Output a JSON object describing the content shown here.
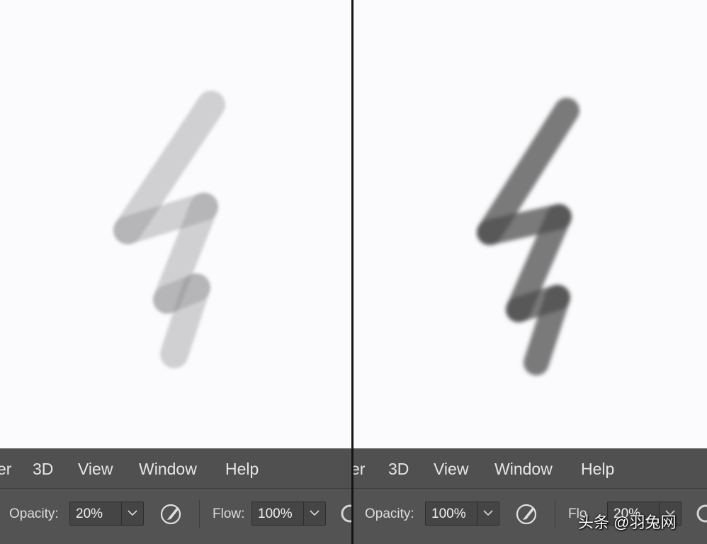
{
  "left_panel": {
    "menu": [
      "er",
      "3D",
      "View",
      "Window",
      "Help"
    ],
    "options": {
      "opacity_label": "Opacity:",
      "opacity_value": "20%",
      "flow_label": "Flow:",
      "flow_value": "100%"
    }
  },
  "right_panel": {
    "menu": [
      "er",
      "3D",
      "View",
      "Window",
      "Help"
    ],
    "options": {
      "opacity_label": "Opacity:",
      "opacity_value": "100%",
      "flow_label": "Flo",
      "flow_value": "20%"
    }
  },
  "watermark": "头条 @羽兔网",
  "colors": {
    "canvas": "#fbfafc",
    "menubar": "#505050",
    "options_bar": "#535353",
    "stroke_left": "#8c8c8e",
    "stroke_right": "#4a4a4a"
  },
  "icons": [
    "chevron-down-icon",
    "airbrush-icon",
    "pressure-opacity-icon"
  ]
}
